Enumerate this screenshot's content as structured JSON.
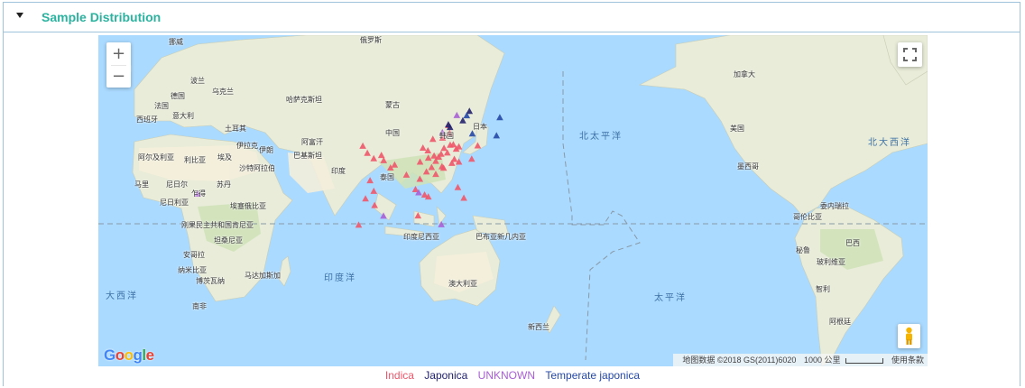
{
  "panel": {
    "title": "Sample Distribution"
  },
  "map": {
    "zoom_in": "+",
    "zoom_out": "−",
    "logo": "Google",
    "attribution": "地图数据 ©2018 GS(2011)6020",
    "scale_label": "1000 公里",
    "terms": "使用条款",
    "countries": [
      "挪威",
      "俄罗斯",
      "英国",
      "波兰",
      "乌克兰",
      "德国",
      "法国",
      "西班牙",
      "意大利",
      "哈萨克斯坦",
      "蒙古",
      "土耳其",
      "伊拉克",
      "伊朗",
      "阿富汗",
      "巴基斯坦",
      "印度",
      "中国",
      "韩国",
      "日本",
      "泰国",
      "阿尔及利亚",
      "利比亚",
      "埃及",
      "马里",
      "尼日尔",
      "乍得",
      "苏丹",
      "尼日利亚",
      "埃塞俄比亚",
      "沙特阿拉伯",
      "刚果民主共和国",
      "肯尼亚",
      "坦桑尼亚",
      "安哥拉",
      "纳米比亚",
      "博茨瓦纳",
      "南非",
      "马达加斯加",
      "印度尼西亚",
      "巴布亚新几内亚",
      "澳大利亚",
      "新西兰",
      "加拿大",
      "美国",
      "墨西哥",
      "委内瑞拉",
      "哥伦比亚",
      "巴西",
      "秘鲁",
      "玻利维亚",
      "智利",
      "阿根廷"
    ],
    "oceans": [
      "北太平洋",
      "北大西洋",
      "印度洋",
      "大西洋",
      "太平洋"
    ],
    "markers": [
      {
        "type": "Indica",
        "lon": 77.2,
        "lat": 28.6
      },
      {
        "type": "Indica",
        "lon": 80.3,
        "lat": 26.4
      },
      {
        "type": "Indica",
        "lon": 85.1,
        "lat": 25.6
      },
      {
        "type": "Indica",
        "lon": 88.4,
        "lat": 22.6
      },
      {
        "type": "Indica",
        "lon": 90.4,
        "lat": 23.8
      },
      {
        "type": "Indica",
        "lon": 84.0,
        "lat": 27.7
      },
      {
        "type": "Indica",
        "lon": 78.5,
        "lat": 17.4
      },
      {
        "type": "Indica",
        "lon": 80.3,
        "lat": 13.1
      },
      {
        "type": "Indica",
        "lon": 76.3,
        "lat": 10.0
      },
      {
        "type": "Indica",
        "lon": 80.7,
        "lat": 7.3
      },
      {
        "type": "Indica",
        "lon": 73.0,
        "lat": -0.7
      },
      {
        "type": "Indica",
        "lon": 75.0,
        "lat": 31.5
      },
      {
        "type": "Indica",
        "lon": 96.1,
        "lat": 19.7
      },
      {
        "type": "Indica",
        "lon": 100.5,
        "lat": 13.8
      },
      {
        "type": "Indica",
        "lon": 102.6,
        "lat": 18.0
      },
      {
        "type": "Indica",
        "lon": 105.8,
        "lat": 21.0
      },
      {
        "type": "Indica",
        "lon": 106.7,
        "lat": 10.8
      },
      {
        "type": "Indica",
        "lon": 104.9,
        "lat": 11.6
      },
      {
        "type": "Indica",
        "lon": 101.7,
        "lat": 3.1
      },
      {
        "type": "Indica",
        "lon": 121.0,
        "lat": 14.6
      },
      {
        "type": "Indica",
        "lon": 123.9,
        "lat": 10.3
      },
      {
        "type": "Indica",
        "lon": 104.1,
        "lat": 30.7
      },
      {
        "type": "Indica",
        "lon": 106.5,
        "lat": 29.6
      },
      {
        "type": "Indica",
        "lon": 102.7,
        "lat": 25.0
      },
      {
        "type": "Indica",
        "lon": 106.7,
        "lat": 26.6
      },
      {
        "type": "Indica",
        "lon": 108.3,
        "lat": 22.8
      },
      {
        "type": "Indica",
        "lon": 110.3,
        "lat": 25.3
      },
      {
        "type": "Indica",
        "lon": 113.3,
        "lat": 23.1
      },
      {
        "type": "Indica",
        "lon": 114.1,
        "lat": 22.5
      },
      {
        "type": "Indica",
        "lon": 110.3,
        "lat": 20.0
      },
      {
        "type": "Indica",
        "lon": 112.9,
        "lat": 28.2
      },
      {
        "type": "Indica",
        "lon": 115.9,
        "lat": 28.7
      },
      {
        "type": "Indica",
        "lon": 114.3,
        "lat": 30.6
      },
      {
        "type": "Indica",
        "lon": 117.3,
        "lat": 31.9
      },
      {
        "type": "Indica",
        "lon": 118.8,
        "lat": 32.1
      },
      {
        "type": "Indica",
        "lon": 120.2,
        "lat": 30.3
      },
      {
        "type": "Indica",
        "lon": 119.3,
        "lat": 26.1
      },
      {
        "type": "Indica",
        "lon": 118.1,
        "lat": 24.5
      },
      {
        "type": "Indica",
        "lon": 121.5,
        "lat": 25.0
      },
      {
        "type": "Indica",
        "lon": 121.5,
        "lat": 31.2
      },
      {
        "type": "Indica",
        "lon": 113.6,
        "lat": 34.8
      },
      {
        "type": "Indica",
        "lon": 108.9,
        "lat": 34.3
      },
      {
        "type": "Indica",
        "lon": 111.7,
        "lat": 27.0
      },
      {
        "type": "Indica",
        "lon": 109.5,
        "lat": 27.5
      },
      {
        "type": "Indica",
        "lon": 117.0,
        "lat": 36.7
      },
      {
        "type": "Indica",
        "lon": 116.4,
        "lat": 39.9
      },
      {
        "type": "Indica",
        "lon": 127.7,
        "lat": 26.2
      },
      {
        "type": "Indica",
        "lon": 130.6,
        "lat": 31.6
      },
      {
        "type": "Japonica",
        "lon": 116.4,
        "lat": 40.2
      },
      {
        "type": "Japonica",
        "lon": 123.4,
        "lat": 41.8
      },
      {
        "type": "Japonica",
        "lon": 126.6,
        "lat": 45.7
      },
      {
        "type": "Japonica",
        "lon": 117.2,
        "lat": 39.1
      },
      {
        "type": "Temperate japonica",
        "lon": 128.0,
        "lat": 36.5
      },
      {
        "type": "Temperate japonica",
        "lon": 139.7,
        "lat": 35.7
      },
      {
        "type": "Temperate japonica",
        "lon": 141.3,
        "lat": 43.1
      },
      {
        "type": "Temperate japonica",
        "lon": 125.3,
        "lat": 43.9
      },
      {
        "type": "UNKNOWN",
        "lon": -5.0,
        "lat": 12.0
      },
      {
        "type": "UNKNOWN",
        "lon": 85.0,
        "lat": 3.0
      },
      {
        "type": "UNKNOWN",
        "lon": 120.5,
        "lat": 44.0
      },
      {
        "type": "UNKNOWN",
        "lon": 113.0,
        "lat": -0.5
      },
      {
        "type": "UNKNOWN",
        "lon": 102.0,
        "lat": 12.5
      },
      {
        "type": "UNKNOWN",
        "lon": 113.5,
        "lat": 37.0
      }
    ]
  },
  "legend": [
    {
      "label": "Indica",
      "color": "#f0566a"
    },
    {
      "label": "Japonica",
      "color": "#22226e"
    },
    {
      "label": "UNKNOWN",
      "color": "#a85fd6"
    },
    {
      "label": "Temperate japonica",
      "color": "#2548a8"
    }
  ]
}
